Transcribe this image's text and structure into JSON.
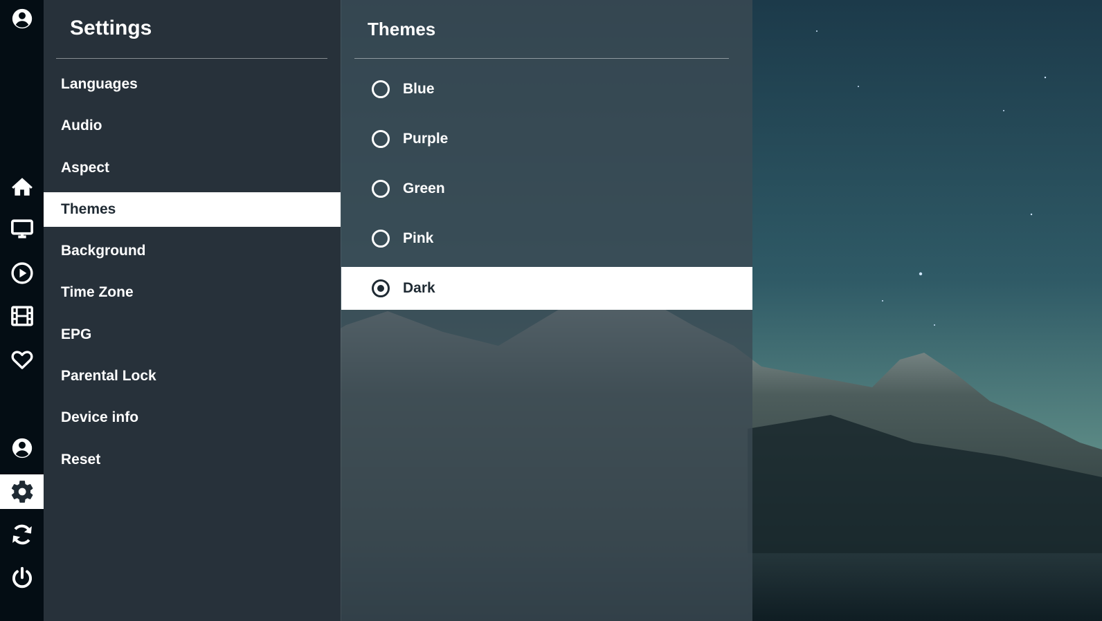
{
  "colors": {
    "rail_bg": "#040d14",
    "settings_bg": "#27313a",
    "themes_bg": "#3c4a53",
    "active_bg": "#ffffff",
    "active_text": "#1f2a33",
    "sky_top": "#1e3e4e",
    "sky_bottom": "#5f8d87"
  },
  "rail": {
    "items": [
      {
        "icon": "account-icon",
        "active": false
      },
      {
        "icon": "home-icon",
        "active": false
      },
      {
        "icon": "monitor-icon",
        "active": false
      },
      {
        "icon": "play-circle-icon",
        "active": false
      },
      {
        "icon": "film-icon",
        "active": false
      },
      {
        "icon": "heart-icon",
        "active": false
      },
      {
        "icon": "account-icon",
        "active": false
      },
      {
        "icon": "gear-icon",
        "active": true
      },
      {
        "icon": "refresh-icon",
        "active": false
      },
      {
        "icon": "power-icon",
        "active": false
      }
    ]
  },
  "settings": {
    "title": "Settings",
    "items": [
      {
        "label": "Languages"
      },
      {
        "label": "Audio"
      },
      {
        "label": "Aspect"
      },
      {
        "label": "Themes",
        "active": true
      },
      {
        "label": "Background"
      },
      {
        "label": "Time Zone"
      },
      {
        "label": "EPG"
      },
      {
        "label": "Parental Lock"
      },
      {
        "label": "Device info"
      },
      {
        "label": "Reset"
      }
    ]
  },
  "themes": {
    "title": "Themes",
    "selected": "Dark",
    "options": [
      {
        "label": "Blue"
      },
      {
        "label": "Purple"
      },
      {
        "label": "Green"
      },
      {
        "label": "Pink"
      },
      {
        "label": "Dark",
        "selected": true
      }
    ]
  }
}
